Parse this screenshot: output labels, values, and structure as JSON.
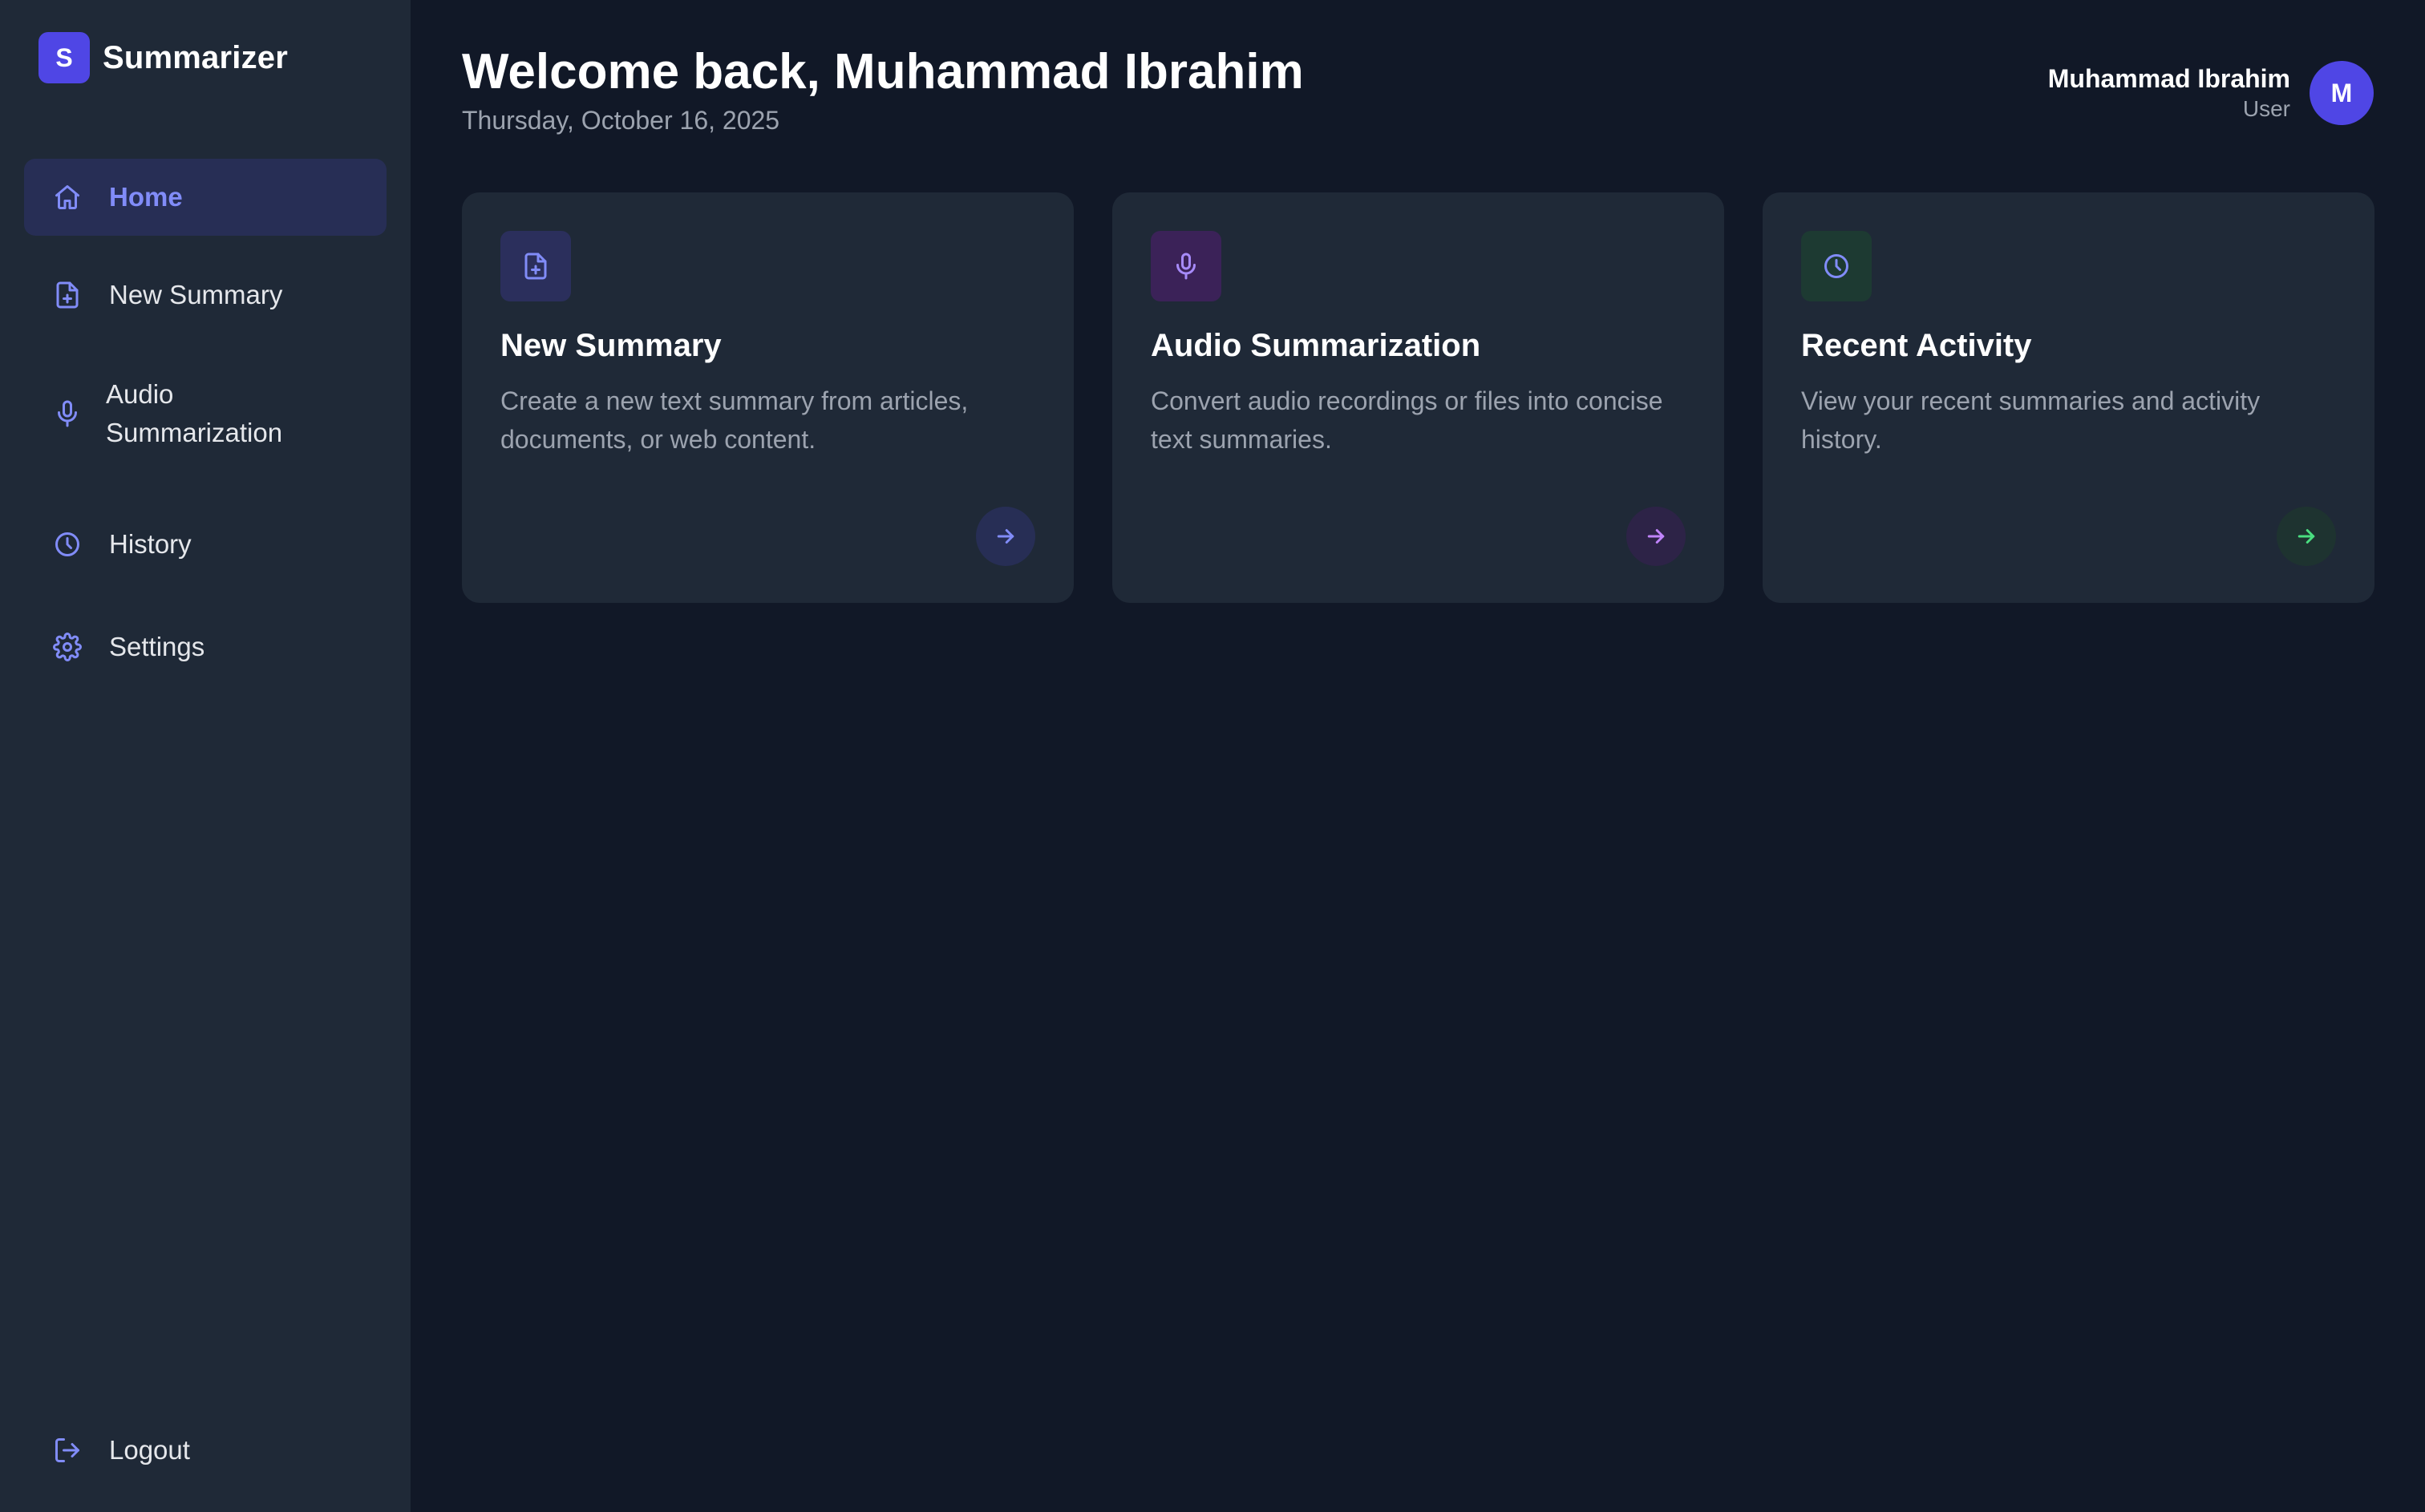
{
  "brand": {
    "logo_letter": "S",
    "name": "Summarizer"
  },
  "sidebar": {
    "items": [
      {
        "label": "Home",
        "icon": "home-icon",
        "active": true
      },
      {
        "label": "New Summary",
        "icon": "file-plus-icon",
        "active": false
      },
      {
        "label": "Audio\nSummarization",
        "label_line1": "Audio",
        "label_line2": "Summarization",
        "icon": "microphone-icon",
        "active": false
      },
      {
        "label": "History",
        "icon": "clock-icon",
        "active": false
      },
      {
        "label": "Settings",
        "icon": "gear-icon",
        "active": false
      }
    ],
    "logout_label": "Logout",
    "logout_icon": "logout-icon"
  },
  "header": {
    "welcome": "Welcome back, Muhammad Ibrahim",
    "date": "Thursday, October 16, 2025"
  },
  "user": {
    "name": "Muhammad Ibrahim",
    "role": "User",
    "avatar_letter": "M"
  },
  "cards": [
    {
      "title": "New Summary",
      "description": "Create a new text summary from articles, documents, or web content.",
      "icon": "file-plus-icon",
      "accent": "#818cf8",
      "icon_bg": "#2b2f5c",
      "arrow_bg": "#272e55"
    },
    {
      "title": "Audio Summarization",
      "description": "Convert audio recordings or files into concise text summaries.",
      "icon": "microphone-icon",
      "accent": "#c084fc",
      "icon_bg": "#3b2258",
      "arrow_bg": "#2d2347"
    },
    {
      "title": "Recent Activity",
      "description": "View your recent summaries and activity history.",
      "icon": "clock-icon",
      "accent": "#4ade80",
      "icon_bg": "#1d3a32",
      "arrow_bg": "#1e3330"
    }
  ],
  "colors": {
    "background": "#111827",
    "sidebar": "#1f2937",
    "card": "#1f2937",
    "primary": "#4f46e5",
    "active_text": "#818cf8",
    "muted_text": "#9ca3af"
  }
}
